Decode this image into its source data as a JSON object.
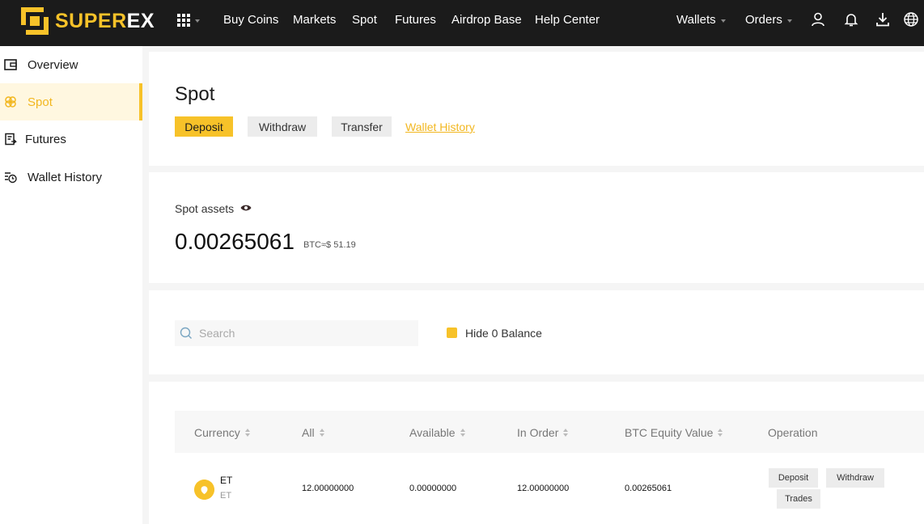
{
  "brand": {
    "name_part1": "SUPER",
    "name_part2": "EX",
    "accent": "#f7c229"
  },
  "nav": {
    "apps_icon": "grid-icon",
    "items": [
      {
        "label": "Buy Coins"
      },
      {
        "label": "Markets"
      },
      {
        "label": "Spot"
      },
      {
        "label": "Futures"
      },
      {
        "label": "Airdrop Base"
      },
      {
        "label": "Help Center"
      }
    ],
    "wallets_label": "Wallets",
    "orders_label": "Orders",
    "icons": [
      "user-icon",
      "bell-icon",
      "download-icon",
      "globe-icon"
    ]
  },
  "sidebar": {
    "items": [
      {
        "label": "Overview",
        "icon": "wallet-icon",
        "active": false
      },
      {
        "label": "Spot",
        "icon": "spot-icon",
        "active": true
      },
      {
        "label": "Futures",
        "icon": "futures-icon",
        "active": false
      },
      {
        "label": "Wallet History",
        "icon": "history-icon",
        "active": false
      }
    ]
  },
  "header": {
    "title": "Spot",
    "deposit_label": "Deposit",
    "withdraw_label": "Withdraw",
    "transfer_label": "Transfer",
    "history_link": "Wallet History"
  },
  "assets": {
    "label": "Spot assets",
    "value": "0.00265061",
    "unit": "BTC≈$ 51.19"
  },
  "filters": {
    "search_placeholder": "Search",
    "search_value": "",
    "hide_zero_label": "Hide 0 Balance",
    "hide_zero_checked": true
  },
  "table": {
    "columns": [
      "Currency",
      "All",
      "Available",
      "In Order",
      "BTC Equity Value",
      "Operation"
    ],
    "rows": [
      {
        "symbol": "ET",
        "name": "ET",
        "all": "12.00000000",
        "available": "0.00000000",
        "in_order": "12.00000000",
        "btc_value": "0.00265061",
        "ops": {
          "deposit": "Deposit",
          "withdraw": "Withdraw",
          "trades": "Trades"
        }
      }
    ]
  }
}
